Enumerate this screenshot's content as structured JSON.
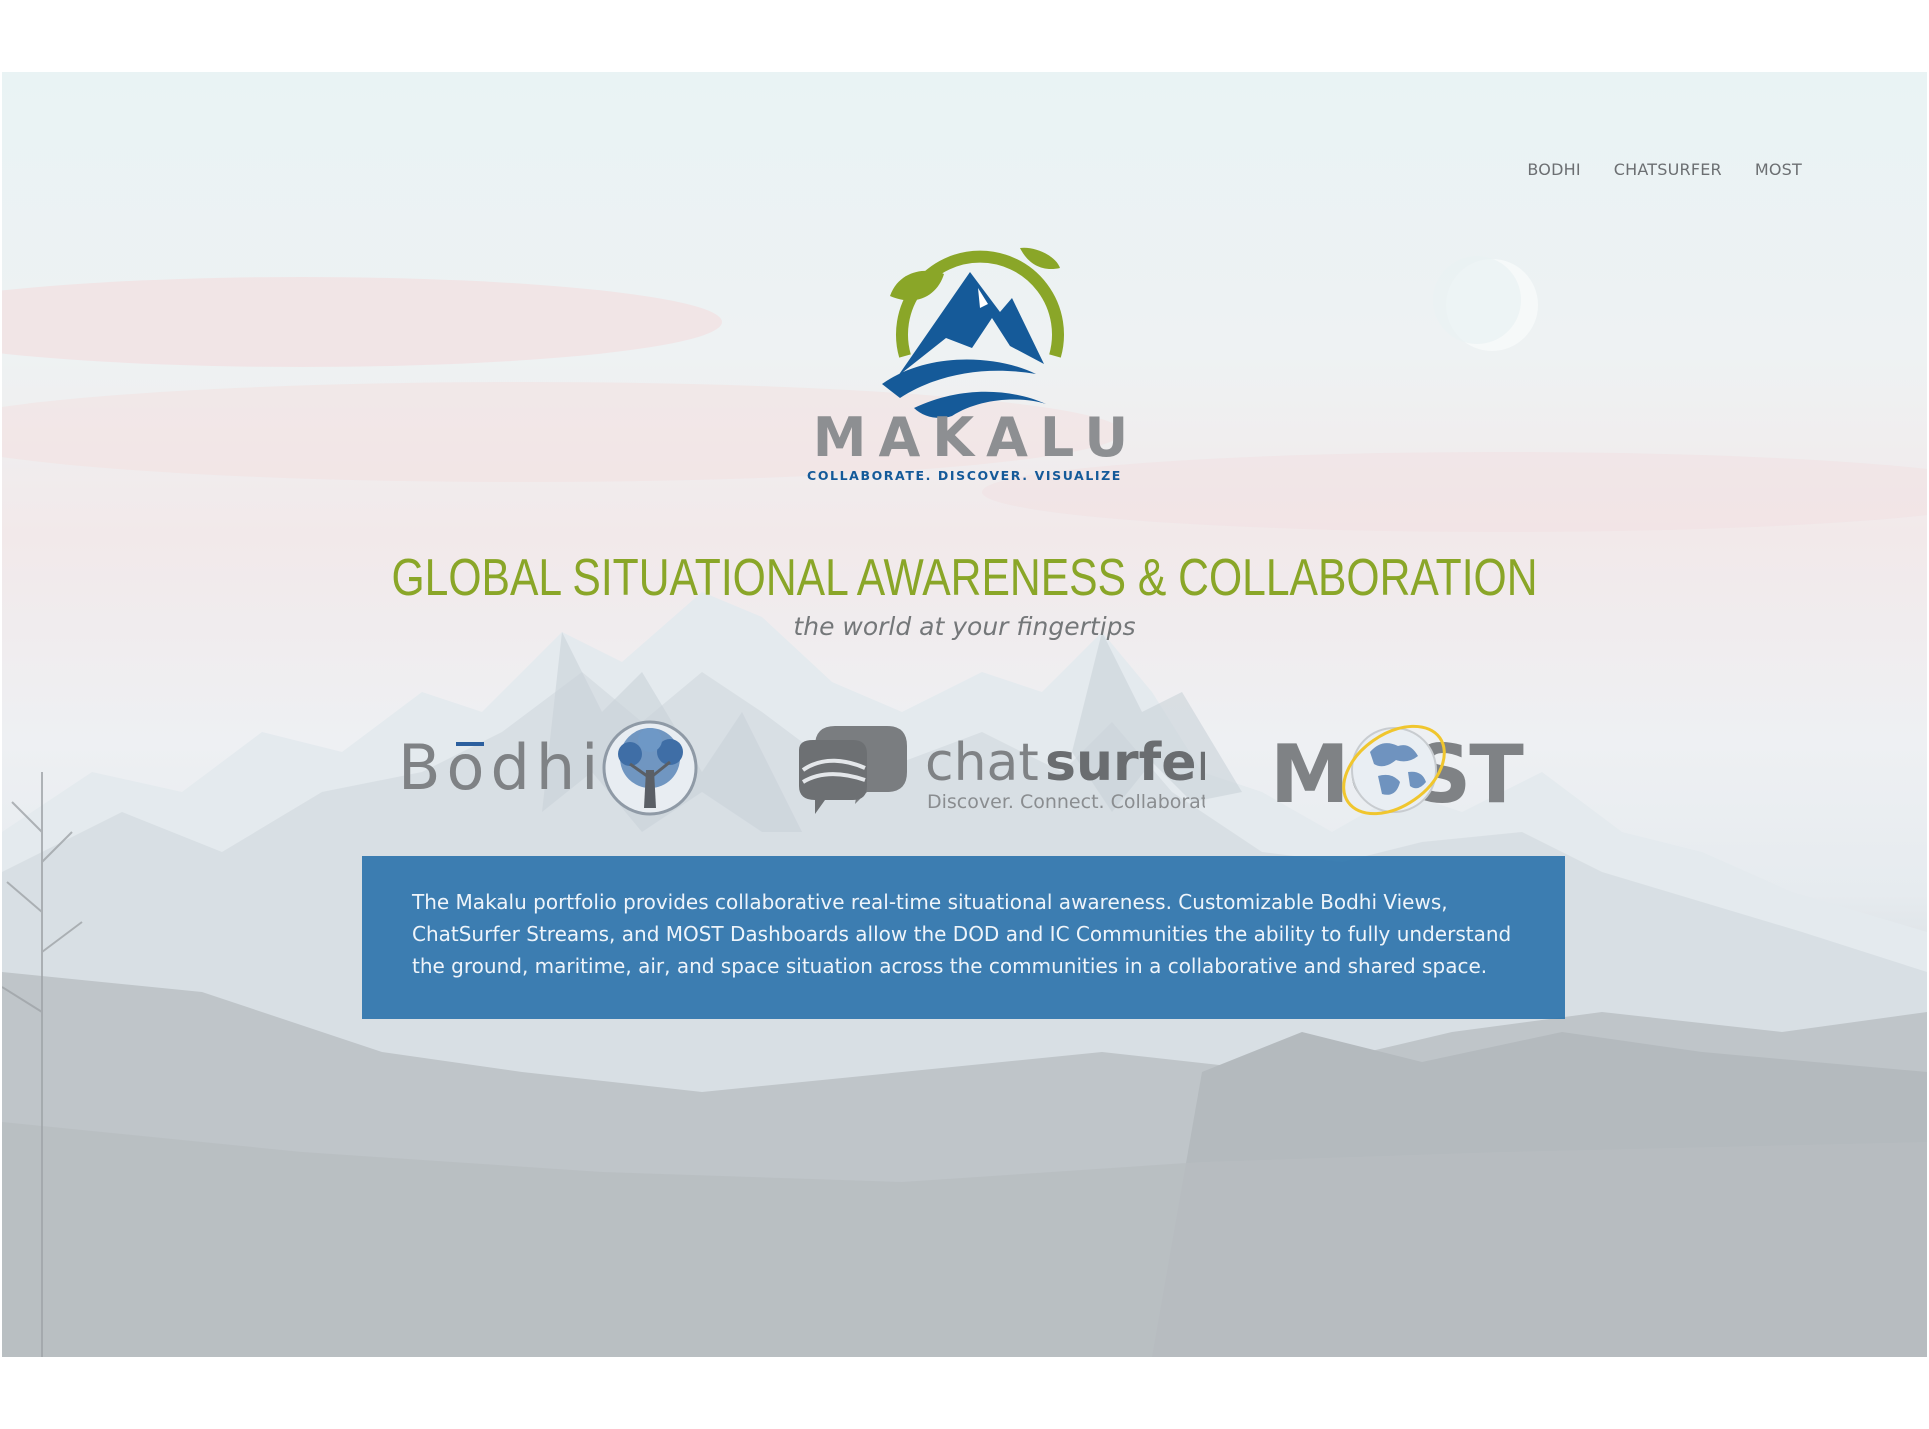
{
  "nav": {
    "items": [
      "BODHI",
      "CHATSURFER",
      "MOST"
    ]
  },
  "brand": {
    "name": "MAKALU",
    "tagline": "COLLABORATE. DISCOVER. VISUALIZE"
  },
  "hero": {
    "headline": "GLOBAL SITUATIONAL AWARENESS & COLLABORATION",
    "subheadline": "the world at your fingertips"
  },
  "products": {
    "bodhi": {
      "name": "Bodhi"
    },
    "chatsurfer": {
      "word_chat": "chat",
      "word_surfer": "surfer",
      "tagline": "Discover. Connect. Collaborate."
    },
    "most": {
      "name": "MOST"
    }
  },
  "description": "The Makalu portfolio provides collaborative real-time situational awareness. Customizable Bodhi Views, ChatSurfer Streams, and MOST Dashboards allow the DOD and IC Communities the ability to fully understand the ground, maritime, air, and space situation across the communities in a collaborative and shared space.",
  "colors": {
    "accent_green": "#8aa628",
    "brand_blue": "#155a99",
    "info_box": "#2670aa",
    "nav_text": "#6c6f72",
    "logo_gray": "#8d8f92"
  },
  "icons": [
    "makalu-logo-icon",
    "bodhi-tree-icon",
    "chatsurfer-bubbles-icon",
    "most-globe-icon",
    "moon-icon"
  ]
}
